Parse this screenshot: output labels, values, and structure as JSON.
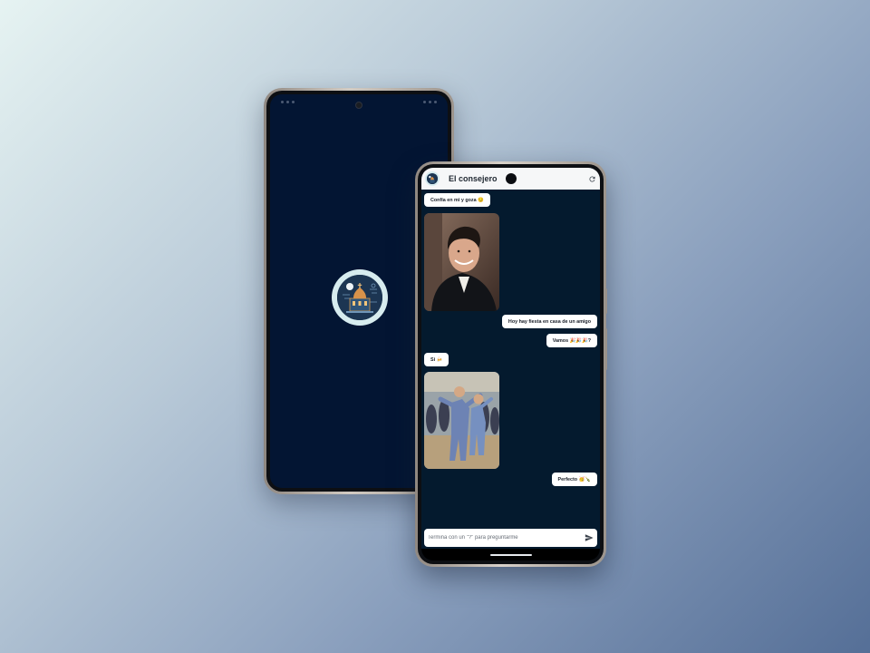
{
  "background": {
    "gradient_start": "#e6f3f2",
    "gradient_end": "#556f97"
  },
  "splash": {
    "screen_color": "#031533",
    "logo_icon": "church-logo-icon"
  },
  "chat": {
    "app_title": "El consejero",
    "refresh_icon": "refresh-icon",
    "screen_color": "#041a2e",
    "messages": [
      {
        "side": "left",
        "type": "text",
        "text": "Confía en mi y goza 😏"
      },
      {
        "side": "left",
        "type": "image",
        "description_icon": "smiling-man-gif"
      },
      {
        "side": "right",
        "type": "text",
        "text": "Hoy hay fiesta en casa de un amigo"
      },
      {
        "side": "right",
        "type": "text",
        "text": "Vamos 🎉🎉🎉?"
      },
      {
        "side": "left",
        "type": "text",
        "text": "Si 🍻"
      },
      {
        "side": "left",
        "type": "image",
        "description_icon": "dancing-men-gif"
      },
      {
        "side": "right",
        "type": "text",
        "text": "Perfecto 🥳🍾"
      }
    ],
    "input": {
      "placeholder": "Termina con un \"?\" para preguntarme",
      "value": ""
    },
    "send_icon": "send-icon"
  }
}
